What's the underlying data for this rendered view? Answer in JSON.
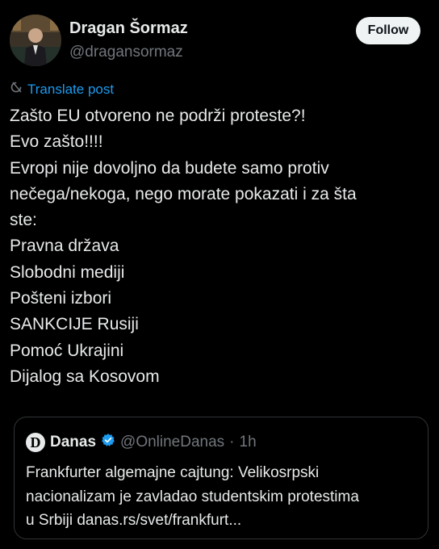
{
  "author": {
    "name": "Dragan Šormaz",
    "handle": "@dragansormaz"
  },
  "follow_label": "Follow",
  "translate_label": "Translate post",
  "tweet_lines": [
    "Zašto EU otvoreno ne podrži proteste?!",
    "Evo zašto!!!!",
    "Evropi nije dovoljno da budete samo protiv",
    "nečega/nekoga, nego morate pokazati i za šta",
    "ste:",
    "Pravna država",
    "Slobodni mediji",
    "Pošteni izbori",
    "SANKCIJE Rusiji",
    "Pomoć Ukrajini",
    "Dijalog sa Kosovom"
  ],
  "quote": {
    "logo_letter": "D",
    "name": "Danas",
    "handle": "@OnlineDanas",
    "separator": "·",
    "time": "1h",
    "lines": [
      "Frankfurter algemajne cajtung: Velikosrpski",
      "nacionalizam je zavladao studentskim protestima",
      "u Srbiji danas.rs/svet/frankfurt..."
    ]
  },
  "colors": {
    "background": "#000000",
    "text": "#e7e9ea",
    "secondary": "#71767b",
    "accent": "#1d9bf0",
    "verified": "#1d9bf0"
  },
  "icons": [
    "translate-icon",
    "verified-badge-icon"
  ]
}
